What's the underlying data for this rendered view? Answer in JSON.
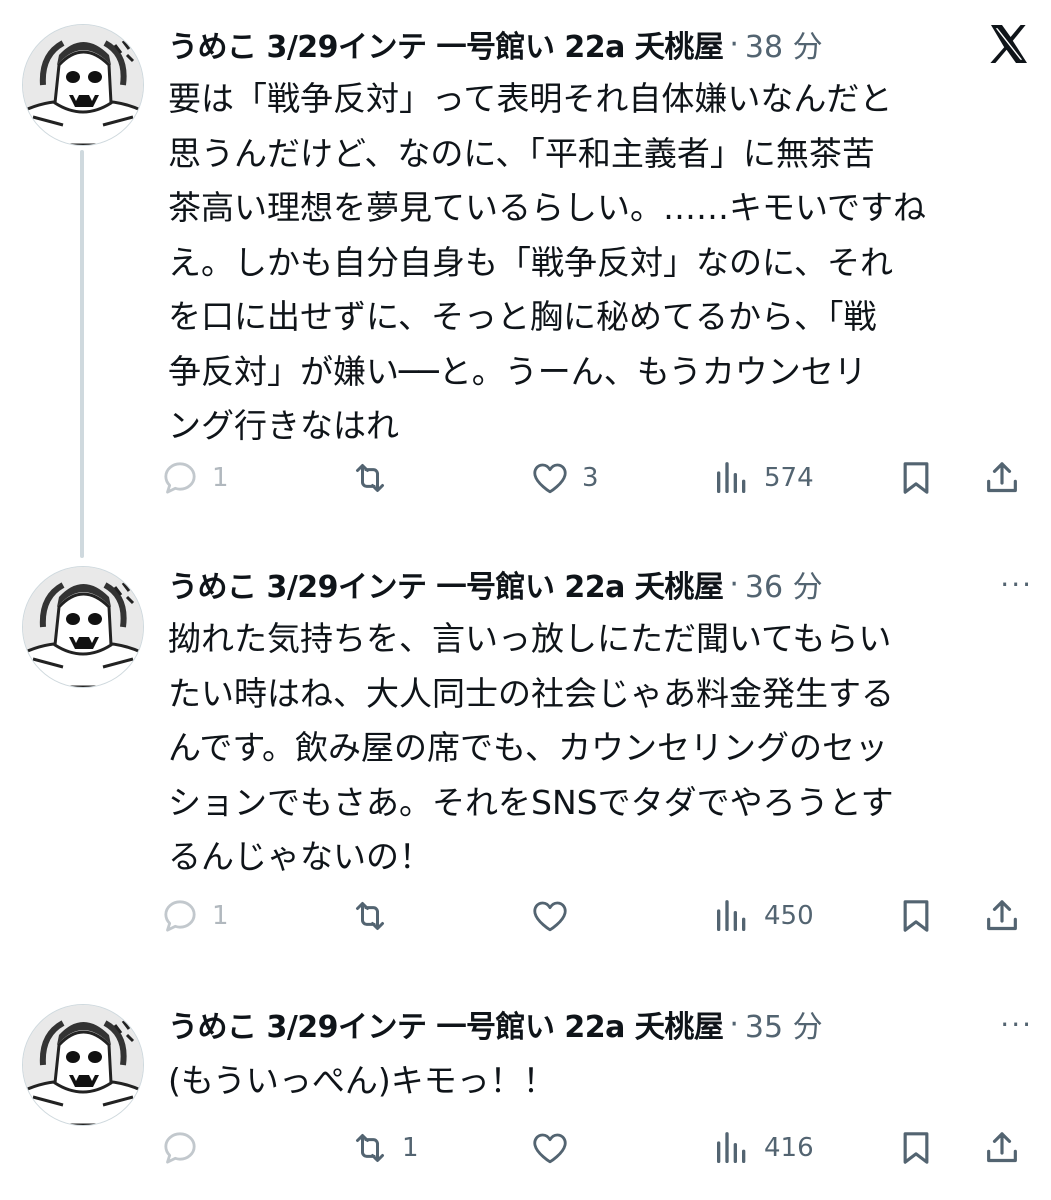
{
  "tweets": [
    {
      "author": "うめこ 3/29インテ 一号館い 22a 夭桃屋",
      "separator": "·",
      "time": "38 分",
      "text": "要は「戦争反対」って表明それ自体嫌いなんだと\n思うんだけど、なのに、「平和主義者」に無茶苦\n茶高い理想を夢見ているらしい。……キモいですね\nえ。しかも自分自身も「戦争反対」なのに、それ\nを口に出せずに、そっと胸に秘めてるから、「戦\n争反対」が嫌い──と。うーん、もうカウンセリ\nング行きなはれ",
      "replies": "1",
      "retweets": "",
      "likes": "3",
      "views": "574"
    },
    {
      "author": "うめこ 3/29インテ 一号館い 22a 夭桃屋",
      "separator": "·",
      "time": "36 分",
      "more": "···",
      "text": "拗れた気持ちを、言いっ放しにただ聞いてもらい\nたい時はね、大人同士の社会じゃあ料金発生する\nんです。飲み屋の席でも、カウンセリングのセッ\nションでもさあ。それをSNSでタダでやろうとす\nるんじゃないの！",
      "replies": "1",
      "retweets": "",
      "likes": "",
      "views": "450"
    },
    {
      "author": "うめこ 3/29インテ 一号館い 22a 夭桃屋",
      "separator": "·",
      "time": "35 分",
      "more": "···",
      "text": "(もういっぺん)キモっ！！",
      "replies": "",
      "retweets": "1",
      "likes": "",
      "views": "416"
    }
  ],
  "icons": {
    "brand": "x-logo-icon",
    "reply": "reply-icon",
    "retweet": "retweet-icon",
    "like": "heart-icon",
    "views": "views-bar-chart-icon",
    "bookmark": "bookmark-icon",
    "share": "share-icon"
  },
  "colors": {
    "text": "#0f1419",
    "secondary": "#536471",
    "thread_line": "#cfd9de",
    "background": "#ffffff"
  }
}
